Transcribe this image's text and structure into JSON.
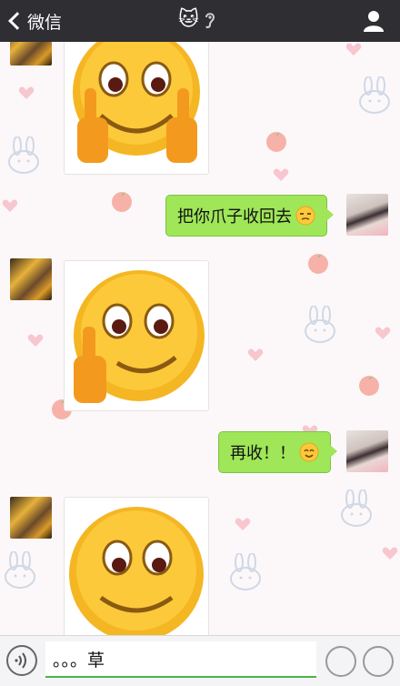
{
  "header": {
    "back_label": "微信",
    "title_emoji": "🐱"
  },
  "messages": [
    {
      "side": "left",
      "kind": "sticker",
      "sticker": "smiley-double-middle-finger"
    },
    {
      "side": "right",
      "kind": "text",
      "text": "把你爪子收回去",
      "emoji": "unamused-face"
    },
    {
      "side": "left",
      "kind": "sticker",
      "sticker": "smiley-single-middle-finger"
    },
    {
      "side": "right",
      "kind": "text",
      "text": "再收！！",
      "emoji": "smiling-face"
    },
    {
      "side": "left",
      "kind": "sticker",
      "sticker": "smiley-face"
    }
  ],
  "input": {
    "value": "。。。草"
  },
  "colors": {
    "topbar": "#2e2e33",
    "bubble_green": "#9fe658",
    "input_accent": "#4bb444",
    "background": "#fcf8f9"
  }
}
